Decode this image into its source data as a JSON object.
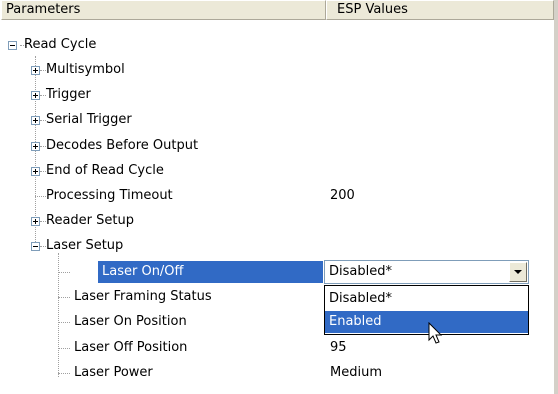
{
  "header": {
    "params_label": "Parameters",
    "values_label": "ESP Values"
  },
  "tree": {
    "root_label": "Read Cycle",
    "items": [
      {
        "label": "Multisymbol",
        "value": ""
      },
      {
        "label": "Trigger",
        "value": ""
      },
      {
        "label": "Serial Trigger",
        "value": ""
      },
      {
        "label": "Decodes Before Output",
        "value": ""
      },
      {
        "label": "End of Read Cycle",
        "value": ""
      },
      {
        "label": "Processing Timeout",
        "value": "200"
      },
      {
        "label": "Reader Setup",
        "value": ""
      },
      {
        "label": "Laser Setup",
        "value": ""
      }
    ],
    "laser_children": [
      {
        "label": "Laser On/Off",
        "value": ""
      },
      {
        "label": "Laser Framing Status",
        "value": ""
      },
      {
        "label": "Laser On Position",
        "value": ""
      },
      {
        "label": "Laser Off Position",
        "value": "95"
      },
      {
        "label": "Laser Power",
        "value": "Medium"
      }
    ]
  },
  "combo": {
    "selected": "Disabled*",
    "options": [
      "Disabled*",
      "Enabled"
    ],
    "highlighted": "Enabled"
  }
}
